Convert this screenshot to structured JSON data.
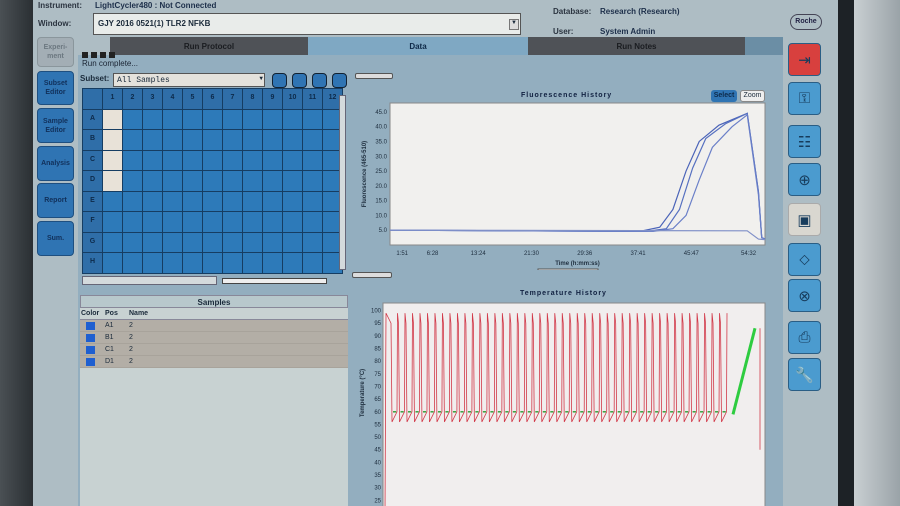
{
  "header": {
    "instrument_label": "Instrument:",
    "instrument_value": "LightCycler480 : Not Connected",
    "window_label": "Window:",
    "window_value": "GJY 2016 0521(1) TLR2 NFKB",
    "database_label": "Database:",
    "database_value": "Research (Research)",
    "user_label": "User:",
    "user_value": "System Admin",
    "logo": "Roche"
  },
  "tabs": [
    "Run Protocol",
    "Data",
    "Run Notes"
  ],
  "active_tab": "Data",
  "sidebar": [
    "Experi-ment",
    "Subset Editor",
    "Sample Editor",
    "Analysis",
    "Report",
    "Sum."
  ],
  "status": "Run complete...",
  "subset": {
    "label": "Subset:",
    "value": "All Samples"
  },
  "plate": {
    "columns": [
      "1",
      "2",
      "3",
      "4",
      "5",
      "6",
      "7",
      "8",
      "9",
      "10",
      "11",
      "12"
    ],
    "rows": [
      "A",
      "B",
      "C",
      "D",
      "E",
      "F",
      "G",
      "H"
    ],
    "selected": [
      "A1",
      "B1",
      "C1",
      "D1"
    ]
  },
  "samples": {
    "title": "Samples",
    "headers": [
      "Color",
      "Pos",
      "Name"
    ],
    "rows": [
      {
        "pos": "A1",
        "name": "2",
        "color": "#1f5fd0"
      },
      {
        "pos": "B1",
        "name": "2",
        "color": "#1f5fd0"
      },
      {
        "pos": "C1",
        "name": "2",
        "color": "#1f5fd0"
      },
      {
        "pos": "D1",
        "name": "2",
        "color": "#1f5fd0"
      }
    ]
  },
  "chart_buttons": {
    "select": "Select",
    "zoom": "Zoom"
  },
  "right_toolbar": [
    "exit-icon",
    "key-icon",
    "network-icon",
    "target-icon",
    "save-icon",
    "back-icon",
    "cancel-icon",
    "print-icon",
    "wrench-icon"
  ],
  "chart_data": [
    {
      "type": "line",
      "title": "Fluorescence History",
      "xlabel": "Time (h:mm:ss)",
      "ylabel": "Fluorescence (465-510)",
      "xticks": [
        "1:51",
        "6:28",
        "13:24",
        "21:30",
        "29:36",
        "37:41",
        "45:47",
        "54:32"
      ],
      "xtick_values": [
        1.85,
        6.47,
        13.4,
        21.5,
        29.6,
        37.7,
        45.8,
        54.5
      ],
      "yticks": [
        "5.0",
        "10.0",
        "15.0",
        "20.0",
        "25.0",
        "30.0",
        "35.0",
        "40.0",
        "45.0"
      ],
      "xlim": [
        0,
        57
      ],
      "ylim": [
        0,
        48
      ],
      "series": [
        {
          "name": "A1",
          "color": "#4a63b8",
          "points": [
            [
              0,
              5
            ],
            [
              38,
              4.6
            ],
            [
              41,
              6
            ],
            [
              43,
              12
            ],
            [
              45,
              25
            ],
            [
              47,
              35
            ],
            [
              50,
              40.5
            ],
            [
              54.3,
              44.5
            ],
            [
              56,
              18
            ],
            [
              56.5,
              2.5
            ],
            [
              57,
              2
            ]
          ]
        },
        {
          "name": "B1",
          "color": "#5670c0",
          "points": [
            [
              0,
              5
            ],
            [
              39,
              4.6
            ],
            [
              42,
              5.5
            ],
            [
              44,
              12
            ],
            [
              46,
              26
            ],
            [
              48,
              36
            ],
            [
              51,
              41
            ],
            [
              54.3,
              44.5
            ],
            [
              56,
              18
            ],
            [
              56.5,
              2.5
            ],
            [
              57,
              2
            ]
          ]
        },
        {
          "name": "C1",
          "color": "#6a7fc8",
          "points": [
            [
              0,
              5
            ],
            [
              40,
              4.6
            ],
            [
              43,
              5.5
            ],
            [
              45,
              10
            ],
            [
              47,
              22
            ],
            [
              49,
              33
            ],
            [
              52,
              40
            ],
            [
              54.3,
              44
            ],
            [
              56,
              17
            ],
            [
              56.5,
              2.5
            ],
            [
              57,
              2
            ]
          ]
        },
        {
          "name": "D1",
          "color": "#8090c8",
          "points": [
            [
              0,
              5
            ],
            [
              54.3,
              4.8
            ],
            [
              56,
              2
            ],
            [
              57,
              1.8
            ]
          ]
        }
      ]
    },
    {
      "type": "line",
      "title": "Temperature History",
      "xlabel": "",
      "ylabel": "Temperature (°C)",
      "yticks": [
        "25",
        "30",
        "35",
        "40",
        "45",
        "50",
        "55",
        "60",
        "65",
        "70",
        "75",
        "80",
        "85",
        "90",
        "95",
        "100"
      ],
      "ylim": [
        20,
        103
      ],
      "cycles": 45,
      "denature_temp": 95,
      "low_temp": 56,
      "anneal_temp": 60,
      "melt": {
        "start": 59,
        "end": 93,
        "color": "#2ecc40"
      },
      "cycle_color": "#d23a4a",
      "anneal_color": "#3aa040"
    }
  ]
}
